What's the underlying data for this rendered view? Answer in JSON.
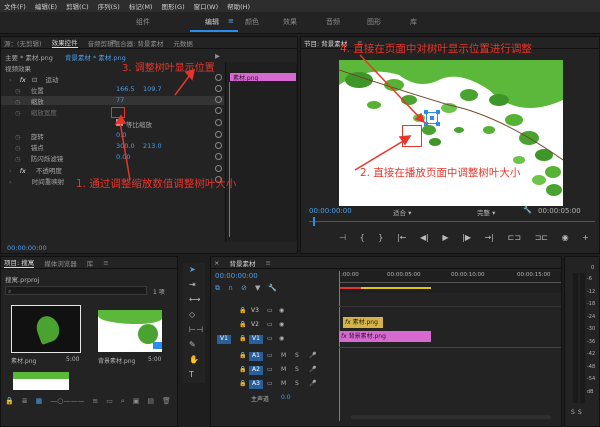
{
  "menu": [
    "文件(F)",
    "编辑(E)",
    "剪辑(C)",
    "序列(S)",
    "标记(M)",
    "图形(G)",
    "窗口(W)",
    "帮助(H)"
  ],
  "workspaces": [
    "组件",
    "编辑",
    "颜色",
    "效果",
    "音频",
    "图形",
    "库"
  ],
  "workspace_menu_glyph": "≡",
  "left_panel": {
    "tabs": [
      "源：(无剪辑)",
      "效果控件",
      "音频剪辑混合器: 背景素材",
      "元数据"
    ],
    "tab_menu_glyph": "≡",
    "clip_selector": "主要 * 素材.png",
    "sequence_label": "背景素材 * 素材.png",
    "play_glyph": "▶",
    "section": "视频效果",
    "motion_label": "运动",
    "fx_glyph": "fx",
    "position_label": "位置",
    "position_x": "166.5",
    "position_y": "109.7",
    "scale_label": "缩放",
    "scale_value": "77",
    "scale_width_label": "缩放宽度",
    "uniform_label": "等比缩放",
    "rotation_label": "旋转",
    "rotation_value": "0.0",
    "anchor_label": "锚点",
    "anchor_x": "300.0",
    "anchor_y": "213.0",
    "flicker_label": "防闪烁滤镜",
    "flicker_value": "0.00",
    "opacity_label": "不透明度",
    "remap_label": "时间重映射",
    "clip_name": "素材.png",
    "timecode": "00:00:00:00"
  },
  "program": {
    "tab": "节目: 背景素材",
    "tab_menu_glyph": "≡",
    "timecode_left": "00:00:00:00",
    "fit": "适合",
    "quality": "完整",
    "timecode_right": "00:00:05:00",
    "wrench_glyph": "🔧",
    "controls": [
      "⊣",
      "{",
      "}",
      "|←",
      "◀|",
      "▶",
      "|▶",
      "→|",
      "⊏⊐",
      "⊐⊏",
      "◉"
    ],
    "add_glyph": "+"
  },
  "project": {
    "tabs": [
      "项目: 搜寓",
      "媒体浏览器",
      "库"
    ],
    "tab_menu_glyph": "≡",
    "file": "搜寓.prproj",
    "counter": "1 项",
    "search_glyph": "⌕",
    "items": [
      {
        "name": "素材.png",
        "duration": "5:00"
      },
      {
        "name": "背景素材.png",
        "duration": "5:00"
      },
      {
        "name": "素材.png",
        "duration": ""
      }
    ]
  },
  "timeline": {
    "tab": "背景素材",
    "tab_menu_glyph": "≡",
    "timecode": "00:00:00:00",
    "ruler": [
      ":00:00",
      "00:00:05:00",
      "00:00:10:00",
      "00:00:15:00"
    ],
    "video_tracks": [
      "V3",
      "V2",
      "V1"
    ],
    "audio_tracks": [
      "A1",
      "A2",
      "A3"
    ],
    "source_v": "V1",
    "source_a": "A1",
    "master": "主声道",
    "master_value": "0.0",
    "clip_v2": "素材.png",
    "clip_v1": "背景素材.png",
    "fx_glyph": "fx",
    "meter_top": "0",
    "meter_scale": [
      "-6",
      "-12",
      "-18",
      "-24",
      "-30",
      "-36",
      "-42",
      "-48",
      "-54",
      "dB"
    ],
    "meter_solo": [
      "S",
      "S"
    ]
  },
  "annotations": {
    "a1": "1. 通过调整缩放数值调整树叶大小",
    "a2": "2. 直接在播放页面中调整树叶大小",
    "a3": "3. 调整树叶显示位置",
    "a4": "4. 直接在页面中对树叶显示位置进行调整"
  },
  "colors": {
    "accent": "#2d8ceb",
    "annotation": "#e8352b",
    "clip_pink": "#d76ad1",
    "clip_gold": "#d6b24d",
    "leaf": "#4aa330"
  }
}
